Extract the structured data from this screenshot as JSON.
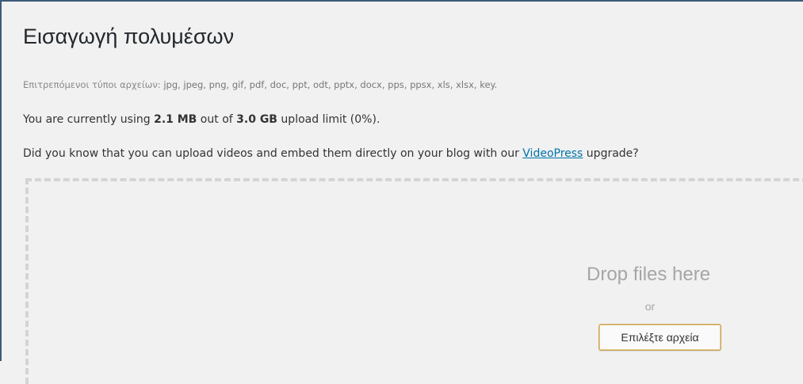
{
  "header": {
    "title": "Εισαγωγή πολυμέσων"
  },
  "upload_info": {
    "allowed_label": "Επιτρεπόμενοι τύποι αρχείων:",
    "allowed_types": "jpg, jpeg, png, gif, pdf, doc, ppt, odt, pptx, docx, pps, ppsx, xls, xlsx, key.",
    "usage_prefix": "You are currently using ",
    "usage_used": "2.1 MB",
    "usage_middle": " out of ",
    "usage_limit": "3.0 GB",
    "usage_suffix": " upload limit (0%).",
    "promo_prefix": "Did you know that you can upload videos and embed them directly on your blog with our ",
    "promo_link": "VideoPress",
    "promo_suffix": " upgrade?"
  },
  "drop_zone": {
    "title": "Drop files here",
    "or_text": "or",
    "select_button": "Επιλέξτε αρχεία"
  },
  "colors": {
    "link": "#0073aa",
    "button_border": "#c8a45a",
    "panel_border": "#3e5a7a"
  }
}
